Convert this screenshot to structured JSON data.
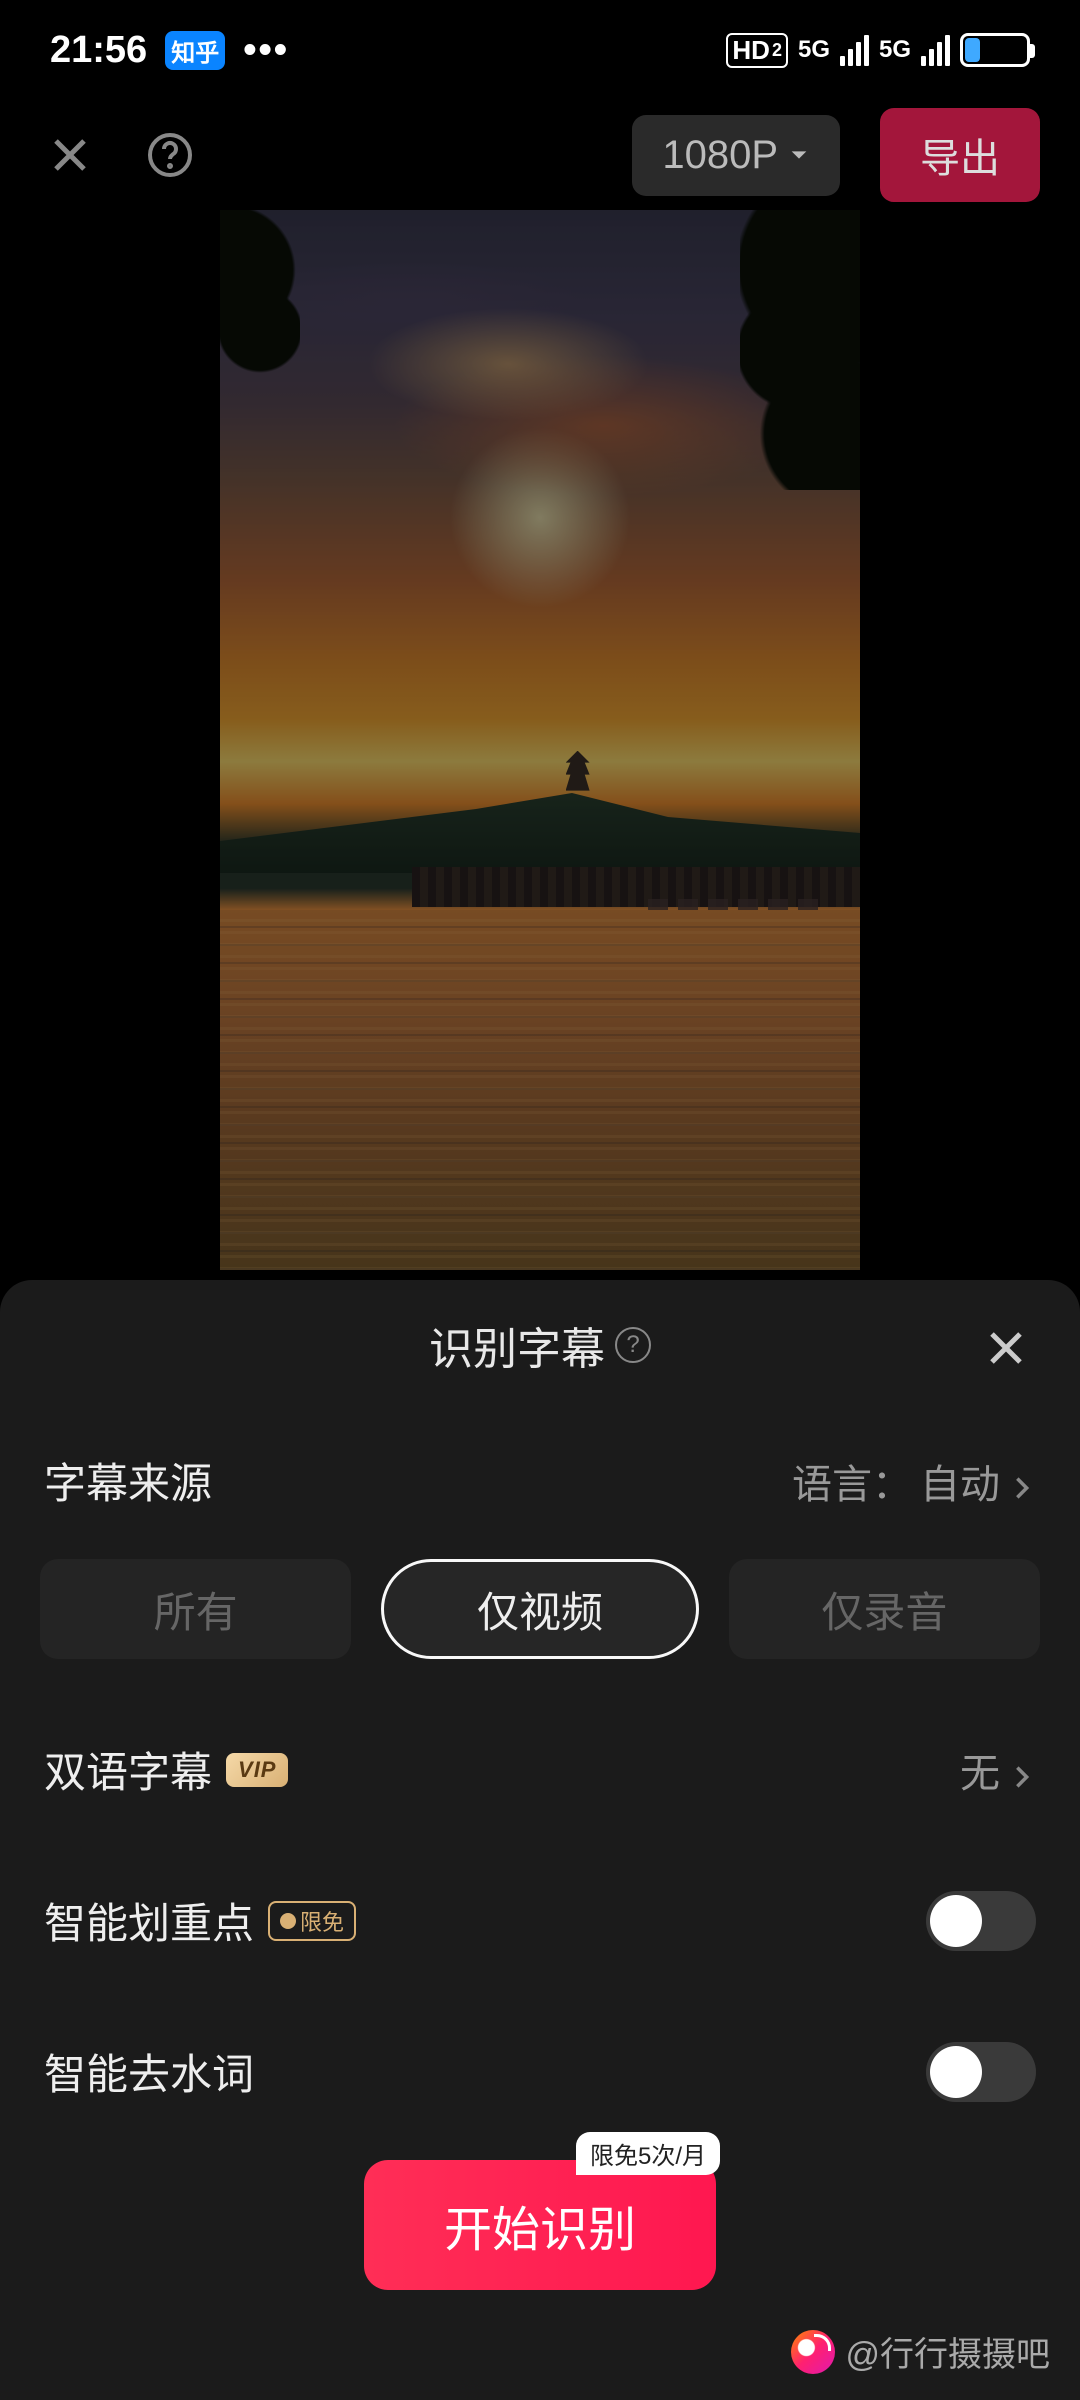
{
  "status": {
    "time": "21:56",
    "app_badge": "知乎",
    "hd": "HD",
    "hd_sub": "2",
    "net1": "5G",
    "net2": "5G"
  },
  "toolbar": {
    "resolution": "1080P",
    "export": "导出"
  },
  "panel": {
    "title": "识别字幕",
    "source_label": "字幕来源",
    "language_label": "语言：",
    "language_value": "自动",
    "tabs": {
      "all": "所有",
      "video": "仅视频",
      "audio": "仅录音"
    },
    "selected_tab": "video",
    "bilingual_label": "双语字幕",
    "bilingual_vip": "VIP",
    "bilingual_value": "无",
    "highlight_label": "智能划重点",
    "highlight_badge": "限免",
    "remove_filler_label": "智能去水词",
    "quota_badge": "限免5次/月",
    "start": "开始识别"
  },
  "watermark": {
    "handle": "@行行摄摄吧"
  }
}
